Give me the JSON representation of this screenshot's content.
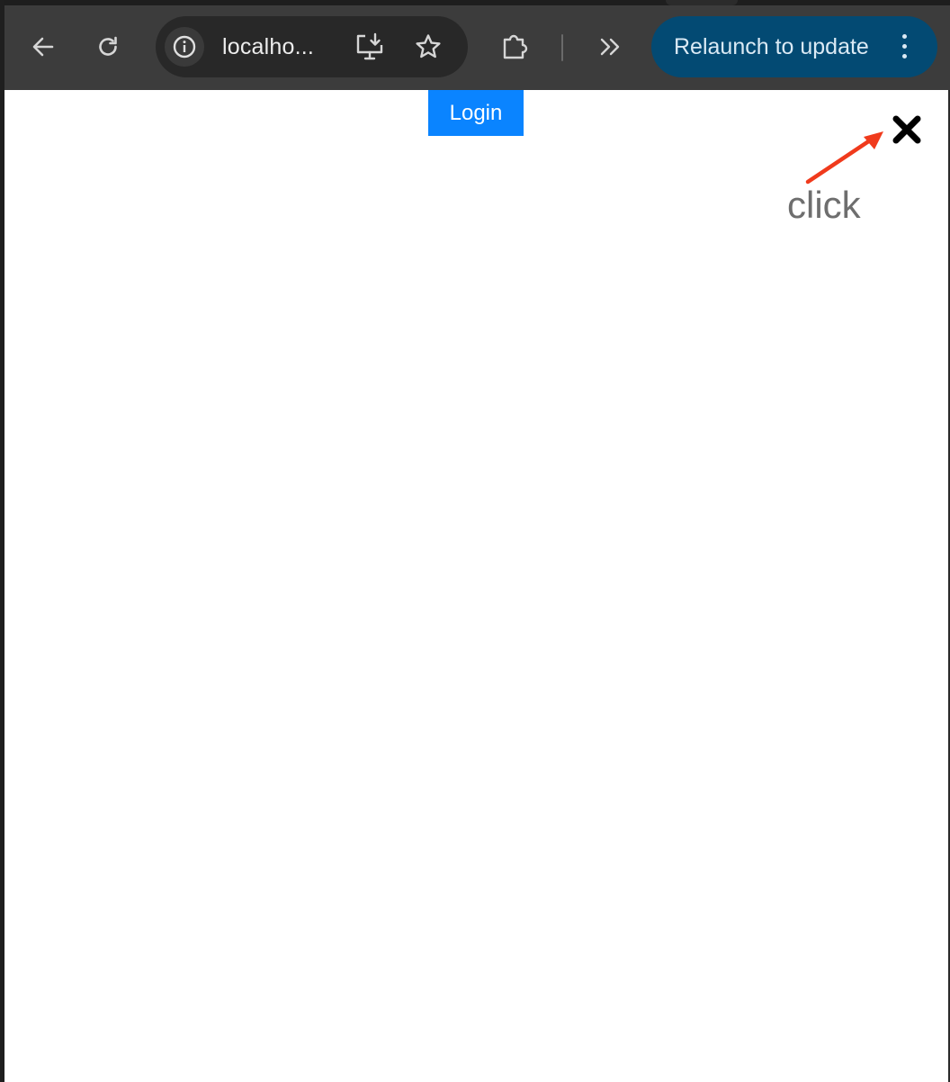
{
  "browser": {
    "url_display": "localho...",
    "relaunch_label": "Relaunch to update",
    "icons": {
      "back": "back-arrow-icon",
      "reload": "reload-icon",
      "site_info": "info-icon",
      "install": "install-app-icon",
      "bookmark": "star-icon",
      "extensions": "puzzle-icon",
      "overflow": "chevron-double-right-icon",
      "menu": "kebab-menu-icon"
    }
  },
  "page": {
    "login_label": "Login",
    "close_glyph": "✖"
  },
  "annotation": {
    "label": "click"
  },
  "colors": {
    "toolbar": "#3c3c3c",
    "omnibox": "#282828",
    "relaunch_bg": "#034a73",
    "login_bg": "#0a84ff",
    "arrow": "#f03a1c"
  }
}
